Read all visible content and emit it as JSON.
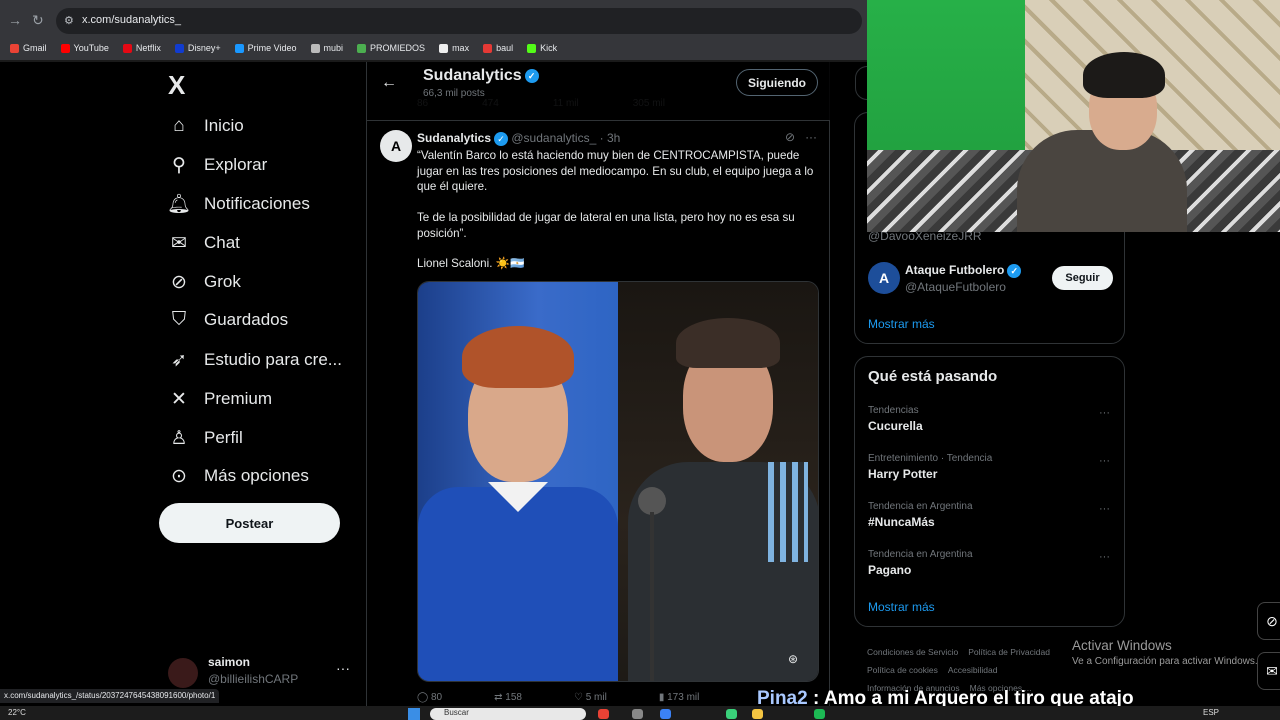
{
  "browser": {
    "url": "x.com/sudanalytics_",
    "bookmarks": [
      {
        "label": "Gmail",
        "color": "#ea4335"
      },
      {
        "label": "YouTube",
        "color": "#ff0000"
      },
      {
        "label": "Netflix",
        "color": "#e50914"
      },
      {
        "label": "Disney+",
        "color": "#113ccf"
      },
      {
        "label": "Prime Video",
        "color": "#1a98ff"
      },
      {
        "label": "mubi",
        "color": "#bbbbbb"
      },
      {
        "label": "PROMIEDOS",
        "color": "#4caf50"
      },
      {
        "label": "max",
        "color": "#eeeeee"
      },
      {
        "label": "baul",
        "color": "#e53935"
      },
      {
        "label": "Kick",
        "color": "#53fc18"
      }
    ],
    "status_url": "x.com/sudanalytics_/status/2037247645438091600/photo/1"
  },
  "nav": {
    "logo": "X",
    "items": [
      {
        "label": "Inicio",
        "icon": "home-icon",
        "glyph": "⌂"
      },
      {
        "label": "Explorar",
        "icon": "search-icon",
        "glyph": "⚲"
      },
      {
        "label": "Notificaciones",
        "icon": "bell-icon",
        "glyph": "🔔︎"
      },
      {
        "label": "Chat",
        "icon": "mail-icon",
        "glyph": "✉"
      },
      {
        "label": "Grok",
        "icon": "grok-icon",
        "glyph": "⊘"
      },
      {
        "label": "Guardados",
        "icon": "bookmark-icon",
        "glyph": "⛉"
      },
      {
        "label": "Estudio para cre...",
        "icon": "rocket-icon",
        "glyph": "➶"
      },
      {
        "label": "Premium",
        "icon": "x-icon",
        "glyph": "✕"
      },
      {
        "label": "Perfil",
        "icon": "person-icon",
        "glyph": "♙"
      },
      {
        "label": "Más opciones",
        "icon": "more-circle-icon",
        "glyph": "⊙"
      }
    ],
    "post_label": "Postear",
    "account": {
      "name": "saimon",
      "handle": "@billieilishCARP",
      "more": "···"
    }
  },
  "profile_header": {
    "back": "←",
    "name": "Sudanalytics",
    "count": "66,3 mil posts",
    "follow_label": "Siguiendo",
    "prev_actions": [
      "86",
      "474",
      "11 mil",
      "305 mil"
    ]
  },
  "tweet": {
    "avatar_letter": "A",
    "name": "Sudanalytics",
    "handle": "@sudanalytics_",
    "time": "· 3h",
    "text_1": "“Valentín Barco lo está haciendo muy bien de CENTROCAMPISTA, puede jugar en las tres posiciones del mediocampo. En su club, el equipo juega a lo que él quiere.",
    "text_2": "Te de la posibilidad de jugar de lateral en una lista, pero hoy no es esa su posición”.",
    "text_3": "Lionel Scaloni. ☀️🇦🇷",
    "actions": {
      "replies": "80",
      "reposts": "158",
      "likes": "5 mil",
      "views": "173 mil"
    }
  },
  "who_to_follow": {
    "partial_handle": "@DavooXeneizeJRR",
    "account_name": "Ataque Futbolero",
    "account_handle": "@AtaqueFutbolero",
    "follow_label": "Seguir",
    "show_more": "Mostrar más"
  },
  "trends": {
    "title": "Qué está pasando",
    "items": [
      {
        "context": "Tendencias",
        "name": "Cucurella"
      },
      {
        "context": "Entretenimiento · Tendencia",
        "name": "Harry Potter"
      },
      {
        "context": "Tendencia en Argentina",
        "name": "#NuncaMás"
      },
      {
        "context": "Tendencia en Argentina",
        "name": "Pagano"
      }
    ],
    "show_more": "Mostrar más"
  },
  "footer": {
    "links": [
      "Condiciones de Servicio",
      "Política de Privacidad",
      "Política de cookies",
      "Accesibilidad",
      "Información de anuncios",
      "Más opciones ..."
    ]
  },
  "activate_windows": {
    "title": "Activar Windows",
    "subtitle": "Ve a Configuración para activar Windows."
  },
  "caption": {
    "user": "Pina2",
    "message": " : Amo a mi Arquero el tiro que atajo"
  },
  "taskbar": {
    "temp": "22°C",
    "search_placeholder": "Buscar",
    "lang": "ESP"
  }
}
